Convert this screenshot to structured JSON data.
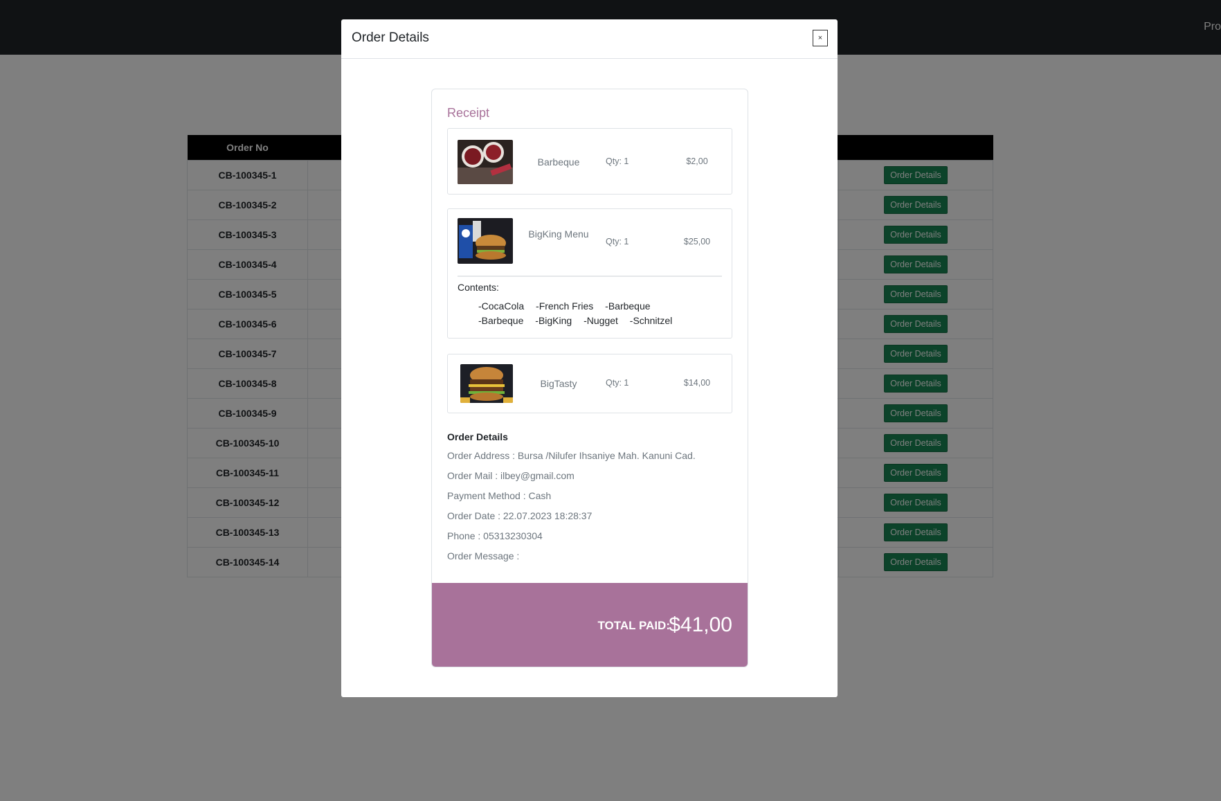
{
  "nav": {
    "right_text": "Pro"
  },
  "table": {
    "header_order_no": "Order No",
    "button_label": "Order Details",
    "rows": [
      "CB-100345-1",
      "CB-100345-2",
      "CB-100345-3",
      "CB-100345-4",
      "CB-100345-5",
      "CB-100345-6",
      "CB-100345-7",
      "CB-100345-8",
      "CB-100345-9",
      "CB-100345-10",
      "CB-100345-11",
      "CB-100345-12",
      "CB-100345-13",
      "CB-100345-14"
    ]
  },
  "modal": {
    "title": "Order Details",
    "close_label": "×",
    "receipt": {
      "title": "Receipt",
      "items": [
        {
          "name": "Barbeque",
          "qty": "Qty: 1",
          "price": "$2,00"
        },
        {
          "name": "BigKing Menu",
          "qty": "Qty: 1",
          "price": "$25,00",
          "contents_label": "Contents:",
          "contents": [
            "-CocaCola",
            "-French Fries",
            "-Barbeque",
            "-Barbeque",
            "-BigKing",
            "-Nugget",
            "-Schnitzel"
          ]
        },
        {
          "name": "BigTasty",
          "qty": "Qty: 1",
          "price": "$14,00"
        }
      ],
      "details": {
        "heading": "Order Details",
        "address": "Order Address : Bursa /Nilufer Ihsaniye Mah. Kanuni Cad.",
        "mail": "Order Mail : ilbey@gmail.com",
        "payment": "Payment Method : Cash",
        "date": "Order Date : 22.07.2023 18:28:37",
        "phone": "Phone : 05313230304",
        "message": "Order Message :"
      },
      "total_label": "TOTAL PAID:",
      "total_value": "$41,00"
    }
  },
  "colors": {
    "accent": "#a8729a",
    "button": "#198754",
    "navbar": "#212529"
  },
  "icons": {
    "thumb_1": "barbeque-sauce-image",
    "thumb_2": "bigking-menu-image",
    "thumb_3": "bigtasty-burger-image"
  }
}
